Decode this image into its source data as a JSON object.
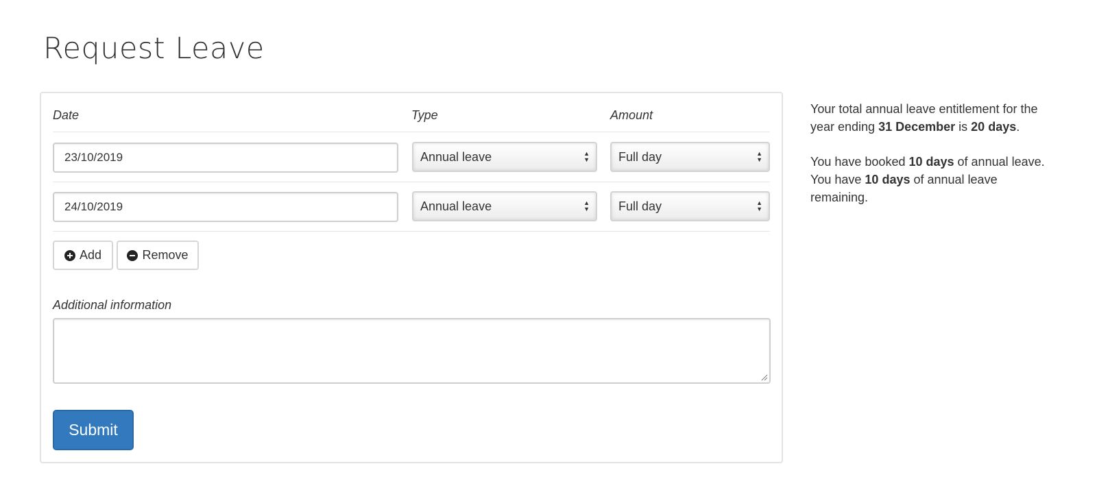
{
  "page": {
    "title": "Request Leave"
  },
  "columns": {
    "date": "Date",
    "type": "Type",
    "amount": "Amount"
  },
  "rows": [
    {
      "date": "23/10/2019",
      "type": "Annual leave",
      "amount": "Full day"
    },
    {
      "date": "24/10/2019",
      "type": "Annual leave",
      "amount": "Full day"
    }
  ],
  "buttons": {
    "add": "Add",
    "remove": "Remove",
    "submit": "Submit"
  },
  "additional_info": {
    "label": "Additional information",
    "value": ""
  },
  "summary": {
    "p1_a": "Your total annual leave entitlement for the year ending ",
    "p1_date": "31 December",
    "p1_b": " is ",
    "p1_total": "20 days",
    "p1_c": ".",
    "p2_a": "You have booked ",
    "p2_booked": "10 days",
    "p2_b": " of annual leave. You have ",
    "p2_remaining": "10 days",
    "p2_c": " of annual leave remaining."
  },
  "icons": {
    "add": "plus-circle-icon",
    "remove": "minus-circle-icon",
    "select": "up-down-arrows-icon"
  },
  "colors": {
    "primary": "#3279be",
    "panel_border": "#e3e3e3",
    "text": "#333333"
  }
}
